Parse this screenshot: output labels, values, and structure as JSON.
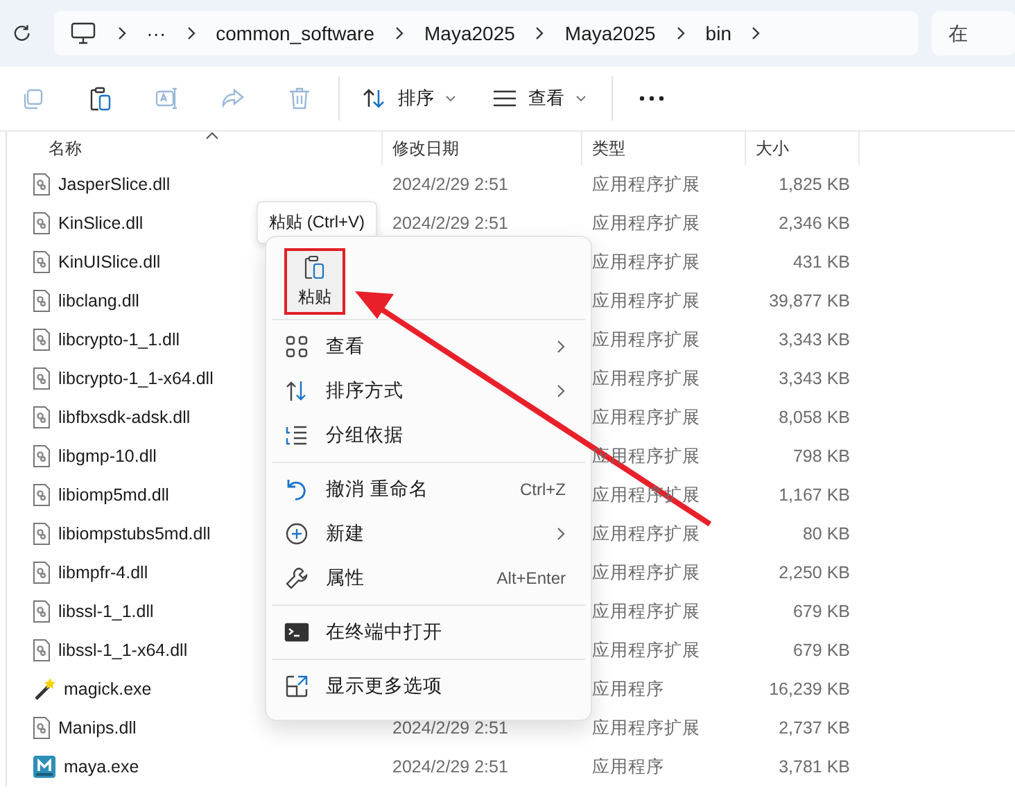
{
  "breadcrumb": {
    "items": [
      "···",
      "common_software",
      "Maya2025",
      "Maya2025",
      "bin"
    ]
  },
  "search": {
    "placeholder": "在"
  },
  "toolbar": {
    "actions": [
      {
        "kind": "copy",
        "disabled": true
      },
      {
        "kind": "paste",
        "disabled": false
      },
      {
        "kind": "rename",
        "disabled": true
      },
      {
        "kind": "share",
        "disabled": true
      },
      {
        "kind": "delete",
        "disabled": true
      }
    ],
    "sort_label": "排序",
    "view_label": "查看"
  },
  "table": {
    "columns": [
      "名称",
      "修改日期",
      "类型",
      "大小"
    ],
    "rows": [
      {
        "kind": "dll",
        "name": "JasperSlice.dll",
        "date": "2024/2/29 2:51",
        "type": "应用程序扩展",
        "size": "1,825 KB"
      },
      {
        "kind": "dll",
        "name": "KinSlice.dll",
        "date": "2024/2/29 2:51",
        "type": "应用程序扩展",
        "size": "2,346 KB"
      },
      {
        "kind": "dll",
        "name": "KinUISlice.dll",
        "type": "应用程序扩展",
        "size": "431 KB"
      },
      {
        "kind": "dll",
        "name": "libclang.dll",
        "type": "应用程序扩展",
        "size": "39,877 KB"
      },
      {
        "kind": "dll",
        "name": "libcrypto-1_1.dll",
        "type": "应用程序扩展",
        "size": "3,343 KB"
      },
      {
        "kind": "dll",
        "name": "libcrypto-1_1-x64.dll",
        "type": "应用程序扩展",
        "size": "3,343 KB"
      },
      {
        "kind": "dll",
        "name": "libfbxsdk-adsk.dll",
        "type": "应用程序扩展",
        "size": "8,058 KB"
      },
      {
        "kind": "dll",
        "name": "libgmp-10.dll",
        "type": "应用程序扩展",
        "size": "798 KB"
      },
      {
        "kind": "dll",
        "name": "libiomp5md.dll",
        "type": "应用程序扩展",
        "size": "1,167 KB"
      },
      {
        "kind": "dll",
        "name": "libiompstubs5md.dll",
        "type": "应用程序扩展",
        "size": "80 KB"
      },
      {
        "kind": "dll",
        "name": "libmpfr-4.dll",
        "type": "应用程序扩展",
        "size": "2,250 KB"
      },
      {
        "kind": "dll",
        "name": "libssl-1_1.dll",
        "type": "应用程序扩展",
        "size": "679 KB"
      },
      {
        "kind": "dll",
        "name": "libssl-1_1-x64.dll",
        "type": "应用程序扩展",
        "size": "679 KB"
      },
      {
        "kind": "wand",
        "name": "magick.exe",
        "type": "应用程序",
        "size": "16,239 KB"
      },
      {
        "kind": "dll",
        "name": "Manips.dll",
        "date": "2024/2/29 2:51",
        "type": "应用程序扩展",
        "size": "2,737 KB"
      },
      {
        "kind": "app",
        "name": "maya.exe",
        "date": "2024/2/29 2:51",
        "type": "应用程序",
        "size": "3,781 KB"
      }
    ]
  },
  "tooltip": "粘贴 (Ctrl+V)",
  "context_menu": {
    "paste_button": {
      "label": "粘贴",
      "highlighted": true
    },
    "sections": [
      [
        {
          "label": "查看",
          "submenu": true
        },
        {
          "label": "排序方式",
          "submenu": true
        },
        {
          "label": "分组依据",
          "submenu": false
        }
      ],
      [
        {
          "label": "撤消 重命名",
          "shortcut": "Ctrl+Z",
          "submenu": false
        },
        {
          "label": "新建",
          "submenu": true
        },
        {
          "label": "属性",
          "shortcut": "Alt+Enter",
          "submenu": false
        }
      ],
      [
        {
          "label": "在终端中打开",
          "submenu": false
        }
      ],
      [
        {
          "label": "显示更多选项",
          "submenu": false
        }
      ]
    ]
  }
}
